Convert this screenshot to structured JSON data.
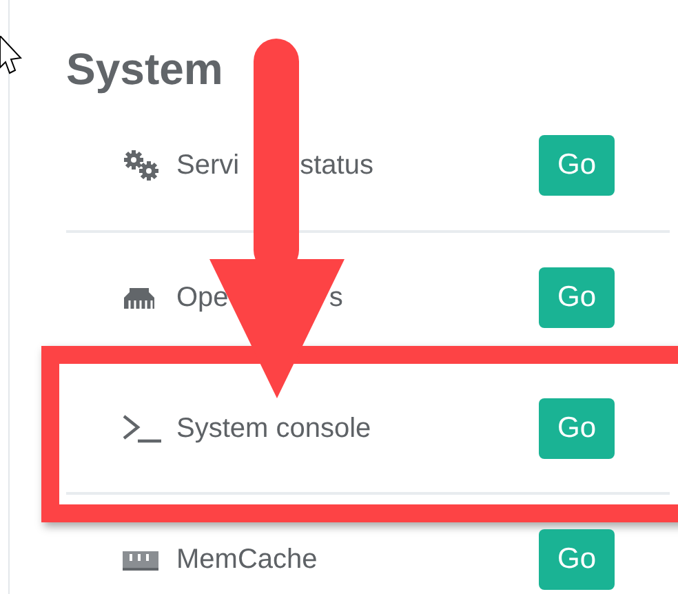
{
  "section": {
    "title": "System"
  },
  "items": [
    {
      "label_fragments": [
        "Servi",
        "status"
      ],
      "button": "Go",
      "highlighted": false
    },
    {
      "label_fragments": [
        "Ope",
        "s"
      ],
      "button": "Go",
      "highlighted": false
    },
    {
      "label_fragments": [
        "System console"
      ],
      "button": "Go",
      "highlighted": true
    },
    {
      "label_fragments": [
        "MemCache"
      ],
      "button": "Go",
      "highlighted": false
    }
  ]
}
